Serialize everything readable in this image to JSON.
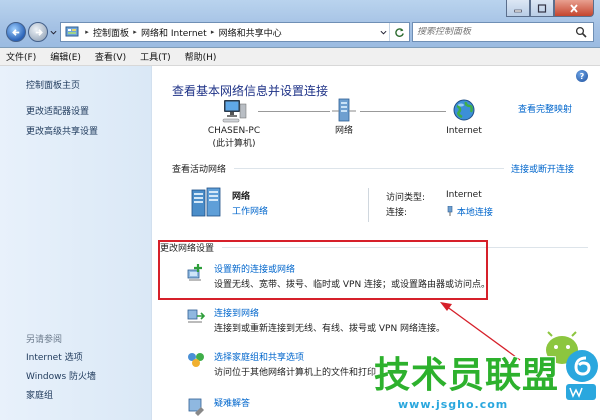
{
  "window": {
    "breadcrumbs": [
      "控制面板",
      "网络和 Internet",
      "网络和共享中心"
    ],
    "search_placeholder": "搜索控制面板"
  },
  "menu": [
    "文件(F)",
    "编辑(E)",
    "查看(V)",
    "工具(T)",
    "帮助(H)"
  ],
  "sidebar": {
    "links": [
      "控制面板主页",
      "更改适配器设置",
      "更改高级共享设置"
    ],
    "see_also_title": "另请参阅",
    "see_also": [
      "Internet 选项",
      "Windows 防火墙",
      "家庭组"
    ]
  },
  "main": {
    "help": "?",
    "title": "查看基本网络信息并设置连接",
    "full_map_link": "查看完整映射",
    "network_map": {
      "computer_name": "CHASEN-PC",
      "computer_sub": "(此计算机)",
      "network": "网络",
      "internet": "Internet"
    },
    "active": {
      "heading": "查看活动网络",
      "connect_link": "连接或断开连接",
      "name": "网络",
      "type": "工作网络",
      "access_label": "访问类型:",
      "access_value": "Internet",
      "connection_label": "连接:",
      "connection_value": "本地连接"
    },
    "change": {
      "heading": "更改网络设置",
      "tasks": [
        {
          "title": "设置新的连接或网络",
          "desc": "设置无线、宽带、拨号、临时或 VPN 连接；或设置路由器或访问点。"
        },
        {
          "title": "连接到网络",
          "desc": "连接到或重新连接到无线、有线、拨号或 VPN 网络连接。"
        },
        {
          "title": "选择家庭组和共享选项",
          "desc": "访问位于其他网络计算机上的文件和打印"
        },
        {
          "title": "疑难解答",
          "desc": ""
        }
      ]
    }
  },
  "watermark": {
    "brand": "技术员联盟",
    "url": "www.jsgho.com"
  },
  "colors": {
    "link": "#0066cc",
    "title": "#1e3287",
    "highlight": "#d6202a",
    "watermark_green": "#2db12d"
  }
}
